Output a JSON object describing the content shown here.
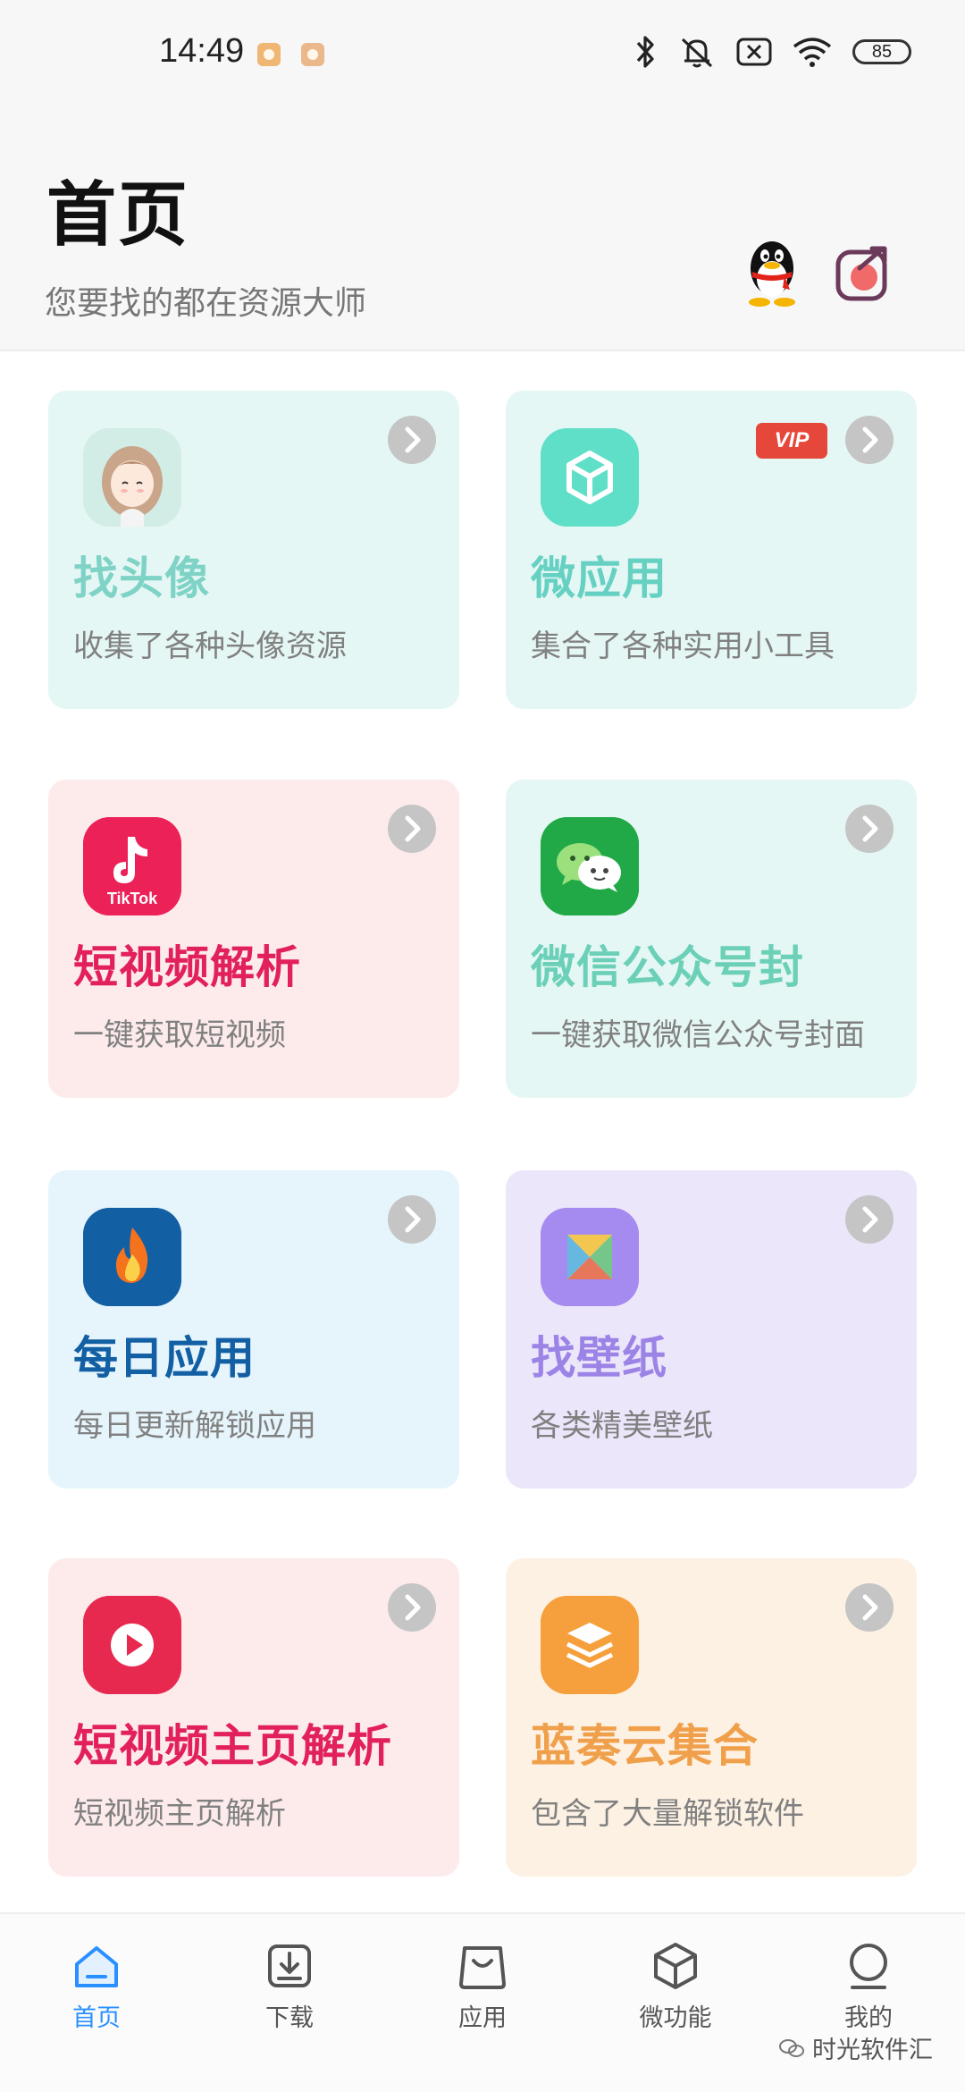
{
  "status_bar": {
    "time": "14:49",
    "battery": "85"
  },
  "header": {
    "title": "首页",
    "subtitle": "您要找的都在资源大师"
  },
  "vip_badge": "VIP",
  "cards": [
    {
      "title": "找头像",
      "desc": "收集了各种头像资源",
      "icon": "avatar-icon",
      "color": "#7fd3c6",
      "bg": "#e5f7f4"
    },
    {
      "title": "微应用",
      "desc": "集合了各种实用小工具",
      "icon": "cube-icon",
      "color": "#66d1c3",
      "bg": "#e5f7f4"
    },
    {
      "title": "短视频解析",
      "desc": "一键获取短视频",
      "icon": "tiktok-icon",
      "color": "#e2215a",
      "bg": "#fdebec"
    },
    {
      "title": "微信公众号封",
      "desc": "一键获取微信公众号封面",
      "icon": "wechat-icon",
      "color": "#6cd0b8",
      "bg": "#e5f7f4"
    },
    {
      "title": "每日应用",
      "desc": "每日更新解锁应用",
      "icon": "flame-icon",
      "color": "#125fa3",
      "bg": "#e6f5fc"
    },
    {
      "title": "找壁纸",
      "desc": "各类精美壁纸",
      "icon": "wallpaper-icon",
      "color": "#9c83e6",
      "bg": "#ece6fb"
    },
    {
      "title": "短视频主页解析",
      "desc": "短视频主页解析",
      "icon": "play-icon",
      "color": "#e2215a",
      "bg": "#fdebec"
    },
    {
      "title": "蓝奏云集合",
      "desc": "包含了大量解锁软件",
      "icon": "layers-icon",
      "color": "#f0a04b",
      "bg": "#fdf1e4"
    }
  ],
  "nav": [
    {
      "label": "首页",
      "icon": "home-icon",
      "active": true
    },
    {
      "label": "下载",
      "icon": "download-icon",
      "active": false
    },
    {
      "label": "应用",
      "icon": "bag-icon",
      "active": false
    },
    {
      "label": "微功能",
      "icon": "cube-icon",
      "active": false
    },
    {
      "label": "我的",
      "icon": "user-icon",
      "active": false
    }
  ],
  "watermark": "时光软件汇",
  "colors": {
    "accent": "#2a90ff",
    "header_bg": "#f7f7f7"
  }
}
